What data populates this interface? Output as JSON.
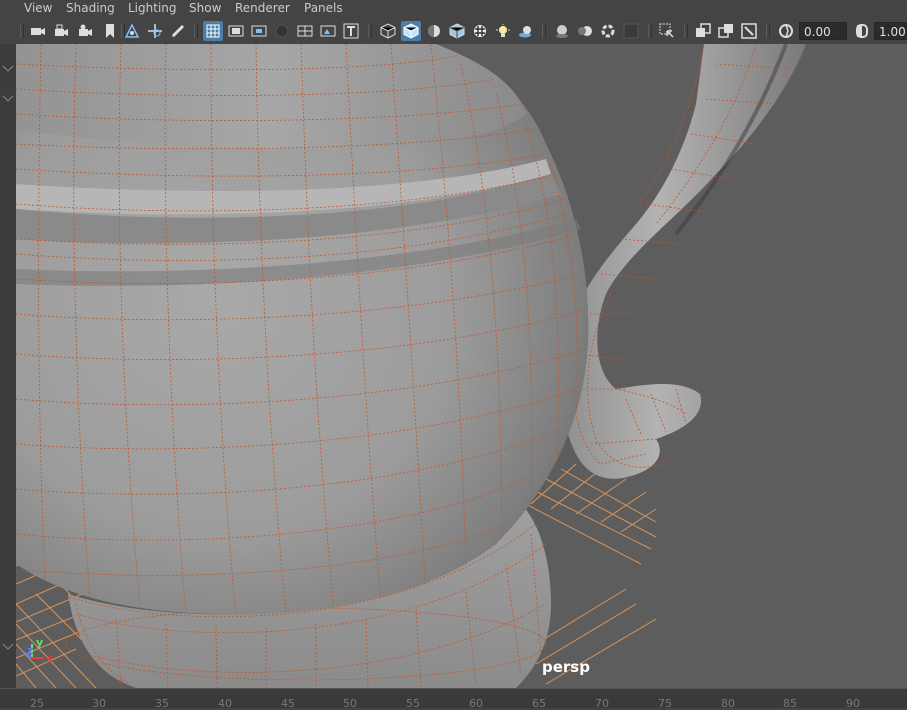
{
  "menu": [
    "View",
    "Shading",
    "Lighting",
    "Show",
    "Renderer",
    "Panels"
  ],
  "toolbar": {
    "exposure_value": "0.00",
    "gamma_value": "1.00"
  },
  "viewport": {
    "camera_label": "persp",
    "axis_labels": {
      "y": "y",
      "z": "z",
      "x": "x"
    }
  },
  "timeline": {
    "ticks": [
      "25",
      "30",
      "35",
      "40",
      "45",
      "50",
      "55",
      "60",
      "65",
      "70",
      "75",
      "80",
      "85",
      "90"
    ]
  },
  "colors": {
    "active_button": "#4a7ea8",
    "wireframe": "#d4541f",
    "grid": "#e89a5a",
    "background": "#5d5d5d"
  }
}
